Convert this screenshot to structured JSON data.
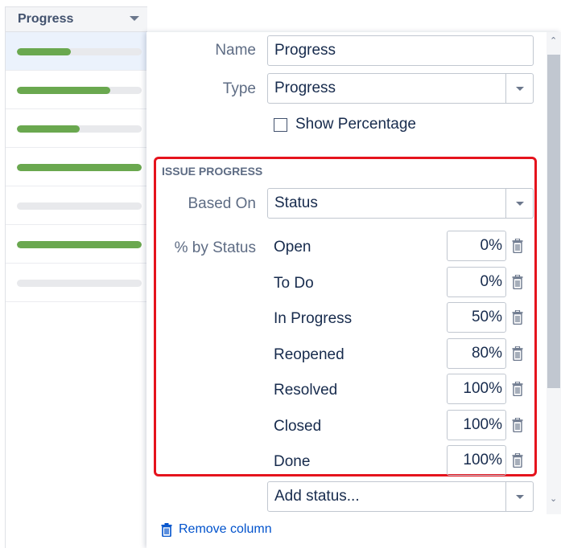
{
  "column": {
    "header": "Progress",
    "rows": [
      {
        "progress": 0.43,
        "selected": true
      },
      {
        "progress": 0.75,
        "selected": false
      },
      {
        "progress": 0.5,
        "selected": false
      },
      {
        "progress": 1.0,
        "selected": false
      },
      {
        "progress": 0.0,
        "selected": false
      },
      {
        "progress": 1.0,
        "selected": false
      },
      {
        "progress": 0.0,
        "selected": false
      }
    ]
  },
  "panel": {
    "name_label": "Name",
    "name_value": "Progress",
    "type_label": "Type",
    "type_value": "Progress",
    "show_percentage_label": "Show Percentage",
    "section_title": "ISSUE PROGRESS",
    "based_on_label": "Based On",
    "based_on_value": "Status",
    "by_status_label": "% by Status",
    "statuses": [
      {
        "name": "Open",
        "percent": "0%"
      },
      {
        "name": "To Do",
        "percent": "0%"
      },
      {
        "name": "In Progress",
        "percent": "50%"
      },
      {
        "name": "Reopened",
        "percent": "80%"
      },
      {
        "name": "Resolved",
        "percent": "100%"
      },
      {
        "name": "Closed",
        "percent": "100%"
      },
      {
        "name": "Done",
        "percent": "100%"
      }
    ],
    "add_status_value": "Add status...",
    "remove_column_label": "Remove column"
  },
  "colors": {
    "progress_fill": "#6aa84f",
    "highlight_border": "#e5131d",
    "link": "#0052cc"
  },
  "icons": {
    "dropdown": "chevron-down-icon",
    "delete": "trash-icon"
  }
}
